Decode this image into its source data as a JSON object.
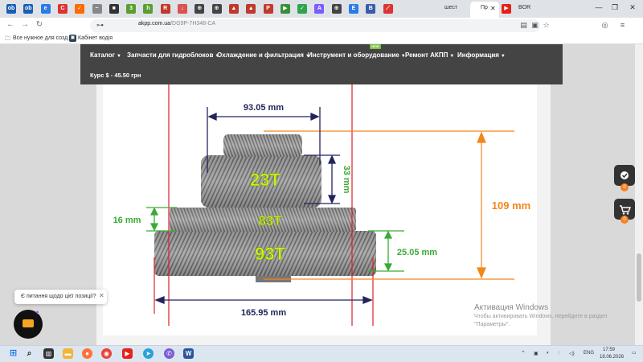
{
  "browser": {
    "tabs_left": [
      {
        "icon": "ob",
        "color": "#1a5fb4"
      },
      {
        "icon": "ob",
        "color": "#1a5fb4"
      },
      {
        "icon": "e",
        "color": "#2c7be5"
      },
      {
        "icon": "C",
        "color": "#d33"
      },
      {
        "icon": "✓",
        "color": "#ff6a00"
      },
      {
        "icon": "~",
        "color": "#888"
      },
      {
        "icon": "■",
        "color": "#333"
      },
      {
        "icon": "3",
        "color": "#5a9e2f"
      },
      {
        "icon": "h",
        "color": "#5a9e2f"
      },
      {
        "icon": "R",
        "color": "#c0392b"
      },
      {
        "icon": "↓",
        "color": "#d9534f"
      },
      {
        "icon": "⊕",
        "color": "#444"
      },
      {
        "icon": "⊕",
        "color": "#444"
      },
      {
        "icon": "▲",
        "color": "#c0392b"
      },
      {
        "icon": "▲",
        "color": "#c0392b"
      },
      {
        "icon": "P",
        "color": "#c0392b"
      },
      {
        "icon": "▶",
        "color": "#3a8f3a"
      },
      {
        "icon": "✓",
        "color": "#2ea44f"
      },
      {
        "icon": "A",
        "color": "#7a5cff"
      },
      {
        "icon": "⊕",
        "color": "#444"
      },
      {
        "icon": "E",
        "color": "#2c7be5"
      },
      {
        "icon": "B",
        "color": "#3a5ba9"
      },
      {
        "icon": "⟋",
        "color": "#d33"
      }
    ],
    "tab_shest": "шест",
    "tab_active": "Пр",
    "tab_bor": "BOR",
    "url_host": "akpp.com.ua",
    "url_path": "/DG9P-7H348-CA",
    "bookmark_1": "Все нужное для созд...",
    "bookmark_2": "Кабінет водія"
  },
  "site": {
    "menu": [
      {
        "label": "Каталог"
      },
      {
        "label": "Запчасти для гидроблоков"
      },
      {
        "label": "Охлаждение и фильтрация"
      },
      {
        "label": "Инструмент и оборудование"
      },
      {
        "label": "Ремонт АКПП"
      },
      {
        "label": "Информация"
      }
    ],
    "new_badge": "NEW",
    "rate": "Курс $ - 45.50 грн"
  },
  "gear_image": {
    "dim_top": "93.05 mm",
    "dim_33": "33 mm",
    "dim_109": "109 mm",
    "dim_16": "16 mm",
    "dim_2505": "25.05 mm",
    "dim_bottom": "165.95 mm",
    "teeth_top": "23T",
    "teeth_mid": "83T",
    "teeth_bottom": "93T",
    "colors": {
      "red": "#e0202a",
      "navy": "#22245e",
      "orange": "#f2861a",
      "green": "#3aaa35",
      "lime": "#c6f21a"
    }
  },
  "side_buttons": {
    "badge_1": "0",
    "badge_2": "0"
  },
  "chat": {
    "question": "Є питання щодо цієї позиції?"
  },
  "activation": {
    "title": "Активация Windows",
    "line1": "Чтобы активировать Windows, перейдите в раздел",
    "line2": "\"Параметры\"."
  },
  "taskbar": {
    "lang": "ENG",
    "time": "17:59",
    "date": "18.06.2026"
  }
}
